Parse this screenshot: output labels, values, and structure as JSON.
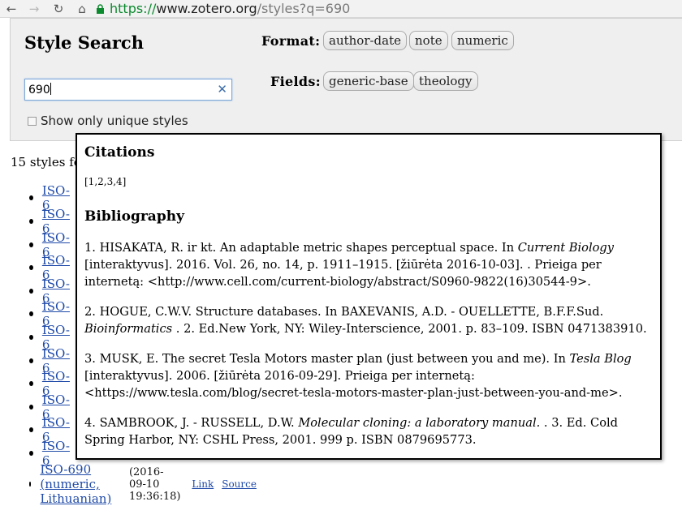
{
  "browser": {
    "url_scheme": "https://",
    "url_host": "www.zotero.org",
    "url_rest": "/styles?q=690"
  },
  "search_panel": {
    "title": "Style Search",
    "search_value": "690",
    "unique_label": "Show only unique styles",
    "format_label": "Format:",
    "formats": [
      "author-date",
      "note",
      "numeric"
    ],
    "fields_label": "Fields:",
    "fields": [
      "generic-base",
      "theology"
    ]
  },
  "results": {
    "count_text": "15 styles fo",
    "items": [
      {
        "label": "ISO-6"
      },
      {
        "label": "ISO-6"
      },
      {
        "label": "ISO-6"
      },
      {
        "label": "ISO-6"
      },
      {
        "label": "ISO-6"
      },
      {
        "label": "ISO-6"
      },
      {
        "label": "ISO-6"
      },
      {
        "label": "ISO-6"
      },
      {
        "label": "ISO-6"
      },
      {
        "label": "ISO-6"
      },
      {
        "label": "ISO-6"
      },
      {
        "label": "ISO-6"
      },
      {
        "label": "ISO-690 (numeric, Lithuanian)",
        "timestamp": "(2016-09-10 19:36:18)",
        "link_label": "Link",
        "source_label": "Source"
      }
    ]
  },
  "preview": {
    "citations_heading": "Citations",
    "citation_value": "[1,2,3,4]",
    "bibliography_heading": "Bibliography",
    "entries": [
      {
        "before": "1. HISAKATA, R. ir kt. An adaptable metric shapes perceptual space. In ",
        "italic": "Current Biology",
        "after": " [interaktyvus]. 2016. Vol. 26, no. 14, p. 1911–1915. [žiūrėta 2016-10-03]. . Prieiga per internetą: <http://www.cell.com/current-biology/abstract/S0960-9822(16)30544-9>."
      },
      {
        "before": "2. HOGUE, C.W.V. Structure databases. In BAXEVANIS, A.D. - OUELLETTE, B.F.F.Sud. ",
        "italic": "Bioinformatics",
        "after": " . 2. Ed.New York, NY: Wiley-Interscience, 2001. p. 83–109. ISBN 0471383910."
      },
      {
        "before": "3. MUSK, E. The secret Tesla Motors master plan (just between you and me). In ",
        "italic": "Tesla Blog",
        "after": " [interaktyvus]. 2006. [žiūrėta 2016-09-29]. Prieiga per internetą: <https://www.tesla.com/blog/secret-tesla-motors-master-plan-just-between-you-and-me>."
      },
      {
        "before": "4. SAMBROOK, J. - RUSSELL, D.W. ",
        "italic": "Molecular cloning: a laboratory manual.",
        "after": " . 3. Ed. Cold Spring Harbor, NY: CSHL Press, 2001. 999 p. ISBN 0879695773."
      }
    ]
  }
}
